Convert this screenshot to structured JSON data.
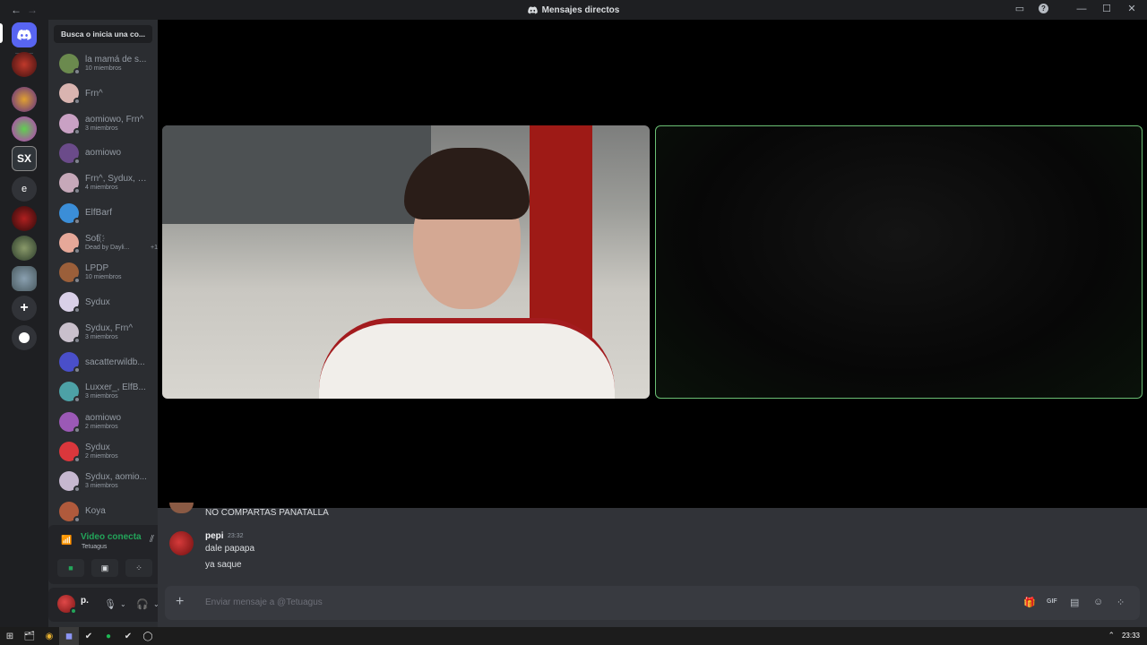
{
  "titlebar": {
    "title": "Mensajes directos",
    "back": "←",
    "forward": "→",
    "icons": [
      "inbox-icon",
      "help-icon",
      "minimize-icon",
      "maximize-icon",
      "close-icon"
    ]
  },
  "rail": {
    "text_servers": [
      {
        "label": "SX"
      },
      {
        "label": "e"
      }
    ]
  },
  "search": {
    "placeholder": "Busca o inicia una co..."
  },
  "dms": [
    {
      "name": "la mamá de s...",
      "sub": "10 miembros",
      "color": "#6b8a4e"
    },
    {
      "name": "Frn^",
      "sub": "",
      "color": "#d9b4b0"
    },
    {
      "name": "aomiowo, Frn^",
      "sub": "3 miembros",
      "color": "#c9a1c4"
    },
    {
      "name": "aomiowo",
      "sub": "",
      "color": "#6b4b8a"
    },
    {
      "name": "Frn^, Sydux, a...",
      "sub": "4 miembros",
      "color": "#c6a8b9"
    },
    {
      "name": "ElfBarf",
      "sub": "",
      "color": "#3b8ed8"
    },
    {
      "name": "Sofi҉",
      "sub": "Dead by Dayli...",
      "extra": "+1",
      "color": "#e6a899"
    },
    {
      "name": "LPDP",
      "sub": "10 miembros",
      "color": "#9b5f3a"
    },
    {
      "name": "Sydux",
      "sub": "",
      "color": "#d9d0e8"
    },
    {
      "name": "Sydux, Frn^",
      "sub": "3 miembros",
      "color": "#c9c0cc"
    },
    {
      "name": "sacatterwildb...",
      "sub": "",
      "color": "#4a4fc9"
    },
    {
      "name": "Luxxer_, ElfB...",
      "sub": "3 miembros",
      "color": "#4da1a6"
    },
    {
      "name": "aomiowo",
      "sub": "2 miembros",
      "color": "#9b59b6"
    },
    {
      "name": "Sydux",
      "sub": "2 miembros",
      "color": "#da373c"
    },
    {
      "name": "Sydux, aomio...",
      "sub": "3 miembros",
      "color": "#c6b8d0"
    },
    {
      "name": "Koya",
      "sub": "",
      "color": "#b05a3c"
    }
  ],
  "voice": {
    "status": "Video conecta",
    "channel": "Tetuagus"
  },
  "user": {
    "name": "p."
  },
  "messages": {
    "previous": "NO COMPARTAS PANATALLA",
    "author": "pepi",
    "time": "23:32",
    "lines": [
      "dale papapa",
      "ya saque"
    ]
  },
  "composer": {
    "placeholder": "Enviar mensaje a @Tetuagus"
  },
  "taskbar": {
    "clock": "23:33"
  },
  "colors": {
    "accent": "#5865f2",
    "connected": "#23a55a",
    "screen_border": "#6abf74"
  }
}
